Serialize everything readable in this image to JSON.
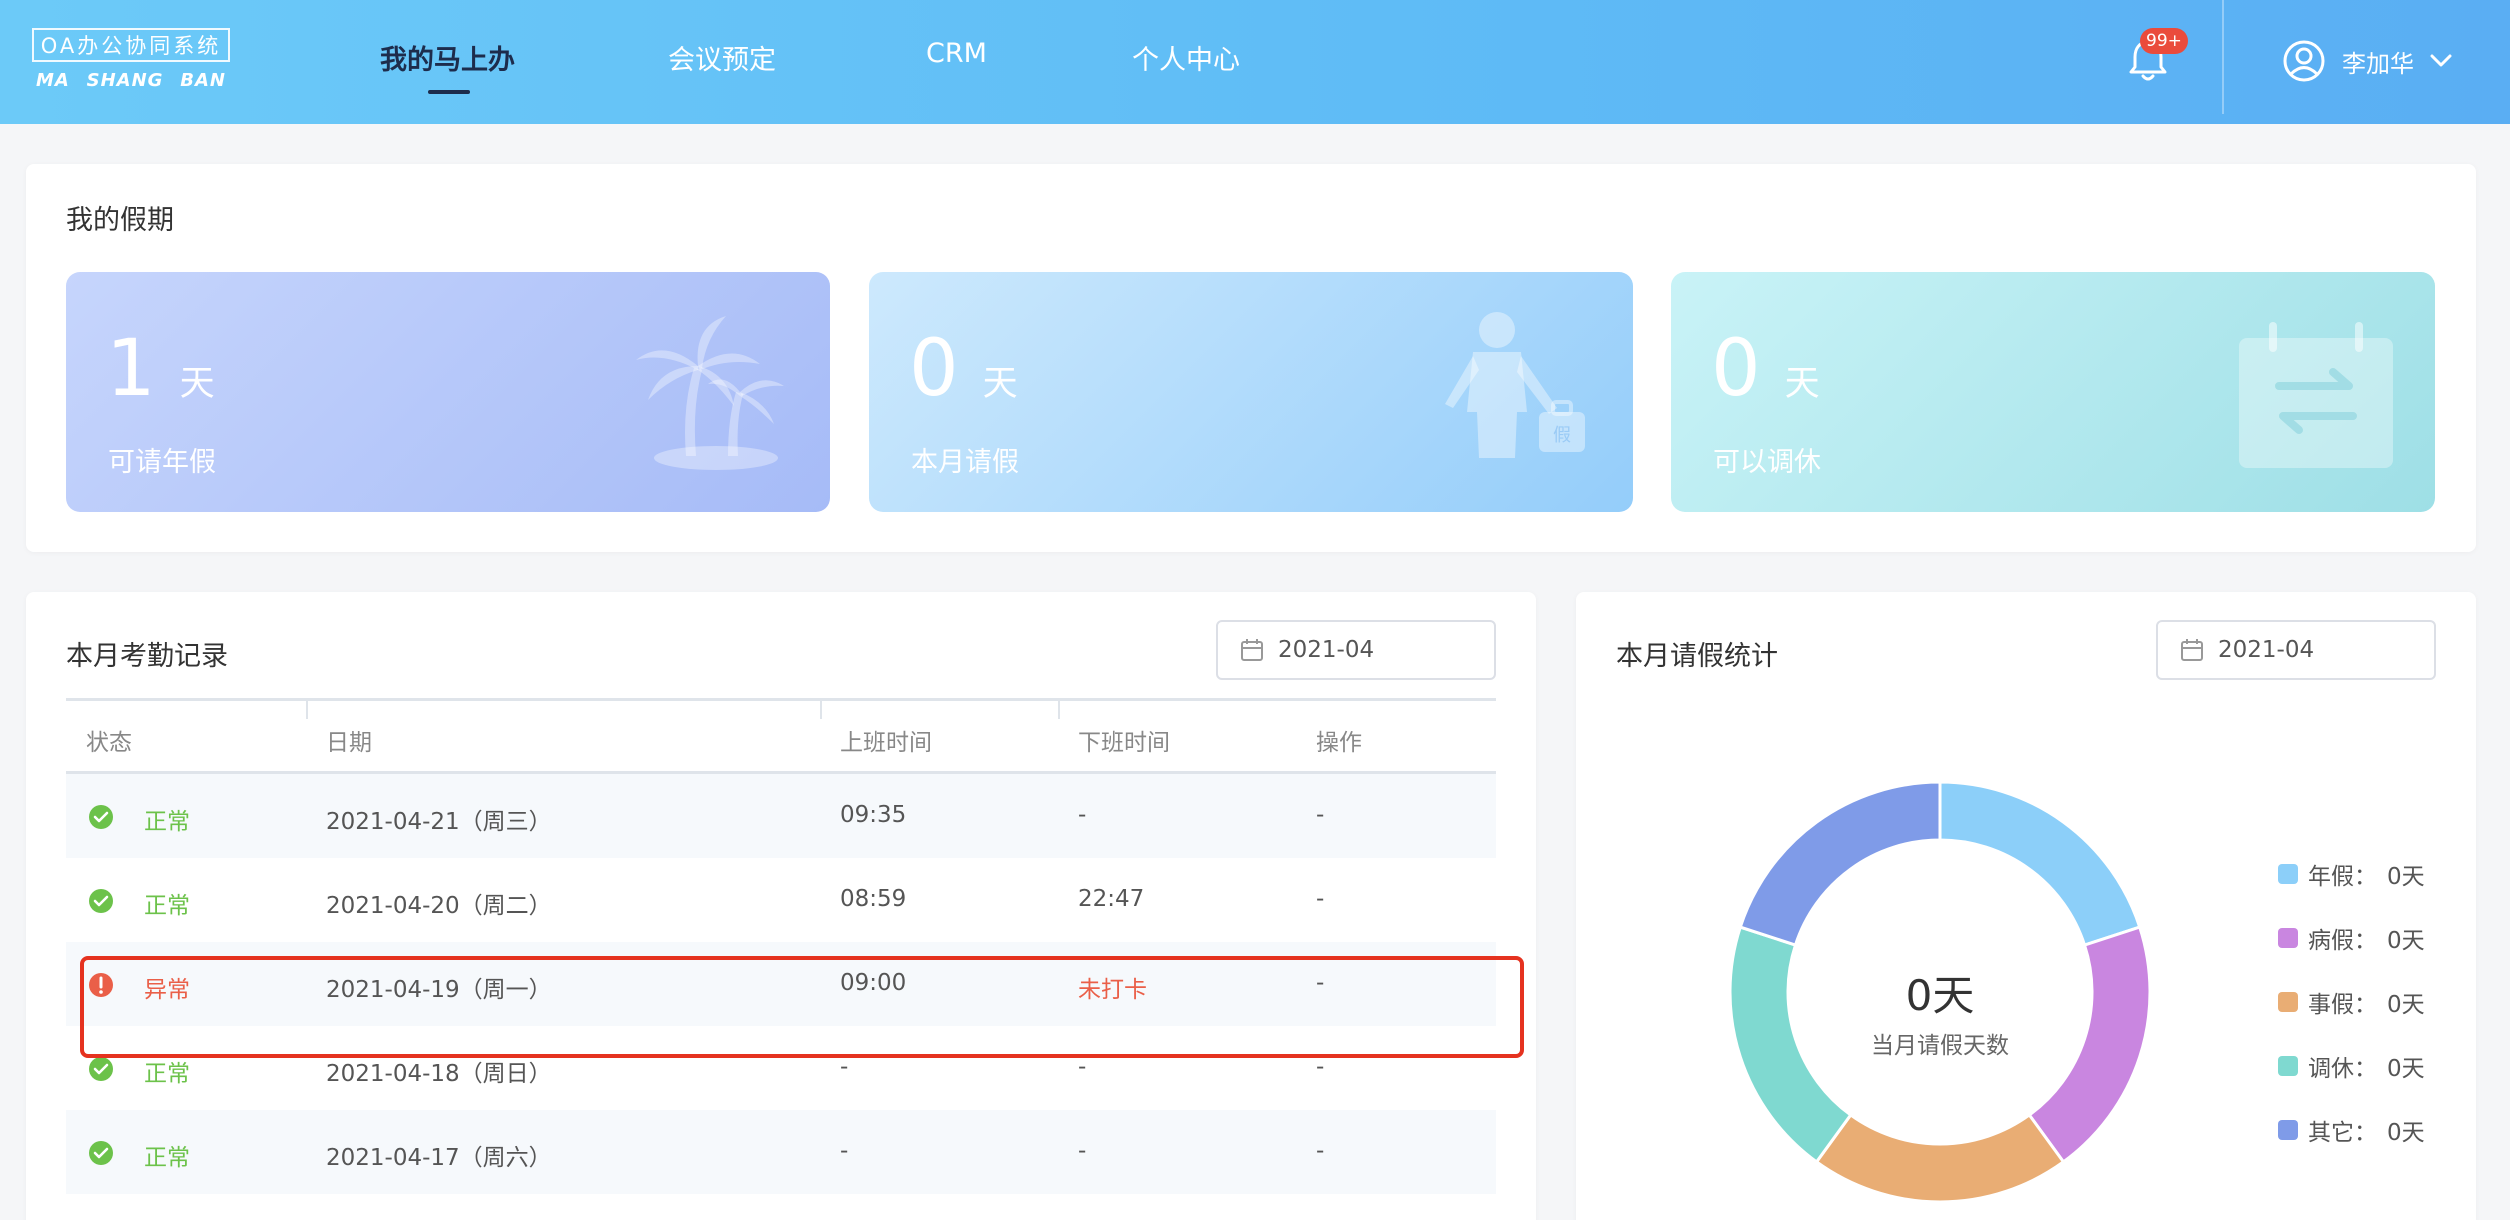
{
  "header": {
    "logo_title": "OA办公协同系统",
    "logo_sub": [
      "MA",
      "SHANG",
      "BAN"
    ],
    "nav": [
      "我的马上办",
      "会议预定",
      "CRM",
      "个人中心"
    ],
    "active_nav": 0,
    "notification_badge": "99+",
    "user_name": "李加华"
  },
  "holiday": {
    "title": "我的假期",
    "stats": [
      {
        "value": "1",
        "unit": "天",
        "label": "可请年假",
        "icon": "palm-tree-icon"
      },
      {
        "value": "0",
        "unit": "天",
        "label": "本月请假",
        "icon": "businessman-leave-icon"
      },
      {
        "value": "0",
        "unit": "天",
        "label": "可以调休",
        "icon": "calendar-swap-icon"
      }
    ]
  },
  "attendance": {
    "title": "本月考勤记录",
    "month": "2021-04",
    "columns": [
      "状态",
      "日期",
      "上班时间",
      "下班时间",
      "操作"
    ],
    "rows": [
      {
        "status": "正常",
        "ok": true,
        "date": "2021-04-21（周三）",
        "in": "09:35",
        "out": "-",
        "op": "-"
      },
      {
        "status": "正常",
        "ok": true,
        "date": "2021-04-20（周二）",
        "in": "08:59",
        "out": "22:47",
        "op": "-"
      },
      {
        "status": "异常",
        "ok": false,
        "date": "2021-04-19（周一）",
        "in": "09:00",
        "out": "未打卡",
        "op": "-"
      },
      {
        "status": "正常",
        "ok": true,
        "date": "2021-04-18（周日）",
        "in": "-",
        "out": "-",
        "op": "-"
      },
      {
        "status": "正常",
        "ok": true,
        "date": "2021-04-17（周六）",
        "in": "-",
        "out": "-",
        "op": "-"
      }
    ]
  },
  "leave": {
    "title": "本月请假统计",
    "month": "2021-04",
    "center_value": "0天",
    "center_label": "当月请假天数",
    "legend": [
      {
        "name": "年假：",
        "value": "0天",
        "color": "#8ccff9"
      },
      {
        "name": "病假：",
        "value": "0天",
        "color": "#c986e0"
      },
      {
        "name": "事假：",
        "value": "0天",
        "color": "#e9ad74"
      },
      {
        "name": "调休：",
        "value": "0天",
        "color": "#7fd9d0"
      },
      {
        "name": "其它：",
        "value": "0天",
        "color": "#7f9be8"
      }
    ]
  },
  "colors": {
    "header_start": "#6ccaf8",
    "header_end": "#5aaef3",
    "ok": "#6cc24a",
    "error": "#ea5f48"
  }
}
